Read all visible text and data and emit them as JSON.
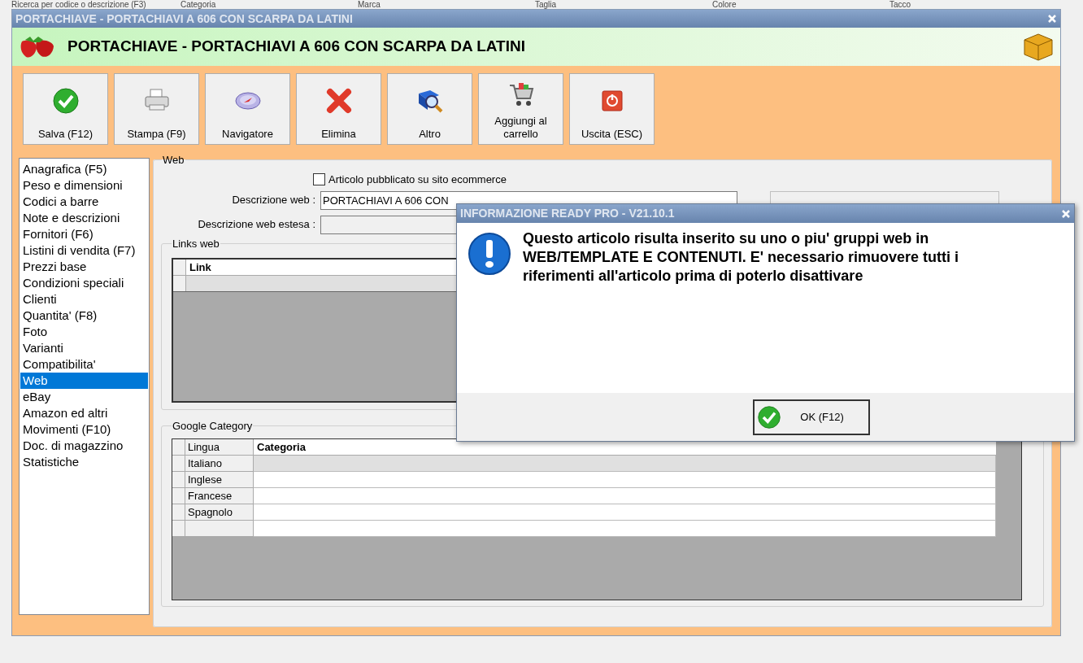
{
  "background_filters": [
    "Ricerca per codice o descrizione (F3)",
    "Categoria",
    "Marca",
    "Taglia",
    "Colore",
    "Tacco"
  ],
  "window": {
    "title": "PORTACHIAVE - PORTACHIAVI A 606 CON SCARPA DA LATINI",
    "heading": "PORTACHIAVE - PORTACHIAVI A 606 CON SCARPA DA LATINI"
  },
  "toolbar": [
    {
      "label": "Salva (F12)",
      "kind": "check"
    },
    {
      "label": "Stampa (F9)",
      "kind": "printer"
    },
    {
      "label": "Navigatore",
      "kind": "compass"
    },
    {
      "label": "Elimina",
      "kind": "cross"
    },
    {
      "label": "Altro",
      "kind": "search-book"
    },
    {
      "label": "Aggiungi al carrello",
      "kind": "cart"
    },
    {
      "label": "Uscita (ESC)",
      "kind": "power"
    }
  ],
  "sidebar": {
    "items": [
      {
        "label": "Anagrafica (F5)",
        "selected": false
      },
      {
        "label": "Peso e dimensioni",
        "selected": false
      },
      {
        "label": "Codici a barre",
        "selected": false
      },
      {
        "label": "Note e descrizioni",
        "selected": false
      },
      {
        "label": "Fornitori (F6)",
        "selected": false
      },
      {
        "label": "Listini di vendita (F7)",
        "selected": false
      },
      {
        "label": "Prezzi base",
        "selected": false
      },
      {
        "label": "Condizioni speciali",
        "selected": false
      },
      {
        "label": "Clienti",
        "selected": false
      },
      {
        "label": "Quantita' (F8)",
        "selected": false
      },
      {
        "label": "Foto",
        "selected": false
      },
      {
        "label": "Varianti",
        "selected": false
      },
      {
        "label": "Compatibilita'",
        "selected": false
      },
      {
        "label": "Web",
        "selected": true
      },
      {
        "label": "eBay",
        "selected": false
      },
      {
        "label": "Amazon ed altri",
        "selected": false
      },
      {
        "label": "Movimenti (F10)",
        "selected": false
      },
      {
        "label": "Doc. di magazzino",
        "selected": false
      },
      {
        "label": "Statistiche",
        "selected": false
      }
    ]
  },
  "web": {
    "legend": "Web",
    "published": {
      "label": "Articolo pubblicato su sito ecommerce",
      "checked": false
    },
    "fields": [
      {
        "label": "Descrizione web :",
        "value": "PORTACHIAVI A 606 CON"
      },
      {
        "label": "Descrizione web estesa :"
      }
    ],
    "links": {
      "legend": "Links web",
      "columns": [
        "Link"
      ]
    },
    "google": {
      "legend": "Google Category",
      "columns": [
        "Lingua",
        "Categoria"
      ],
      "rows": [
        {
          "lingua": "Italiano",
          "selected": true
        },
        {
          "lingua": "Inglese",
          "selected": false
        },
        {
          "lingua": "Francese",
          "selected": false
        },
        {
          "lingua": "Spagnolo",
          "selected": false
        },
        {
          "selected": false
        }
      ]
    }
  },
  "dialog": {
    "title": "INFORMAZIONE READY PRO - V21.10.1",
    "message": "Questo articolo risulta inserito su uno o piu' gruppi web in WEB/TEMPLATE E CONTENUTI. E' necessario rimuovere tutti i riferimenti all'articolo prima di poterlo disattivare",
    "ok": "OK (F12)"
  }
}
